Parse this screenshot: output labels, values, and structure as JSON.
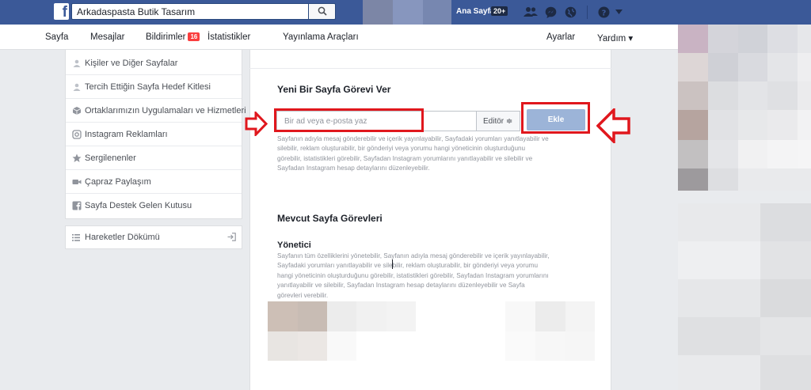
{
  "topbar": {
    "search_value": "Arkadaspasta Butik Tasarım",
    "home_label": "Ana Sayfa",
    "home_badge": "20+"
  },
  "pagenav": {
    "items": [
      {
        "label": "Sayfa"
      },
      {
        "label": "Mesajlar"
      },
      {
        "label": "Bildirimler",
        "badge": "16"
      },
      {
        "label": "İstatistikler"
      },
      {
        "label": "Yayınlama Araçları"
      }
    ],
    "settings_label": "Ayarlar",
    "help_label": "Yardım ▾"
  },
  "sidebar": {
    "items": [
      {
        "label": "Kişiler ve Diğer Sayfalar",
        "icon": "people-icon"
      },
      {
        "label": "Tercih Ettiğin Sayfa Hedef Kitlesi",
        "icon": "people-icon"
      },
      {
        "label": "Ortaklarımızın Uygulamaları ve Hizmetleri",
        "icon": "cube-icon"
      },
      {
        "label": "Instagram Reklamları",
        "icon": "instagram-icon"
      },
      {
        "label": "Sergilenenler",
        "icon": "star-icon"
      },
      {
        "label": "Çapraz Paylaşım",
        "icon": "video-icon"
      },
      {
        "label": "Sayfa Destek Gelen Kutusu",
        "icon": "facebook-icon"
      }
    ],
    "activity_log_label": "Hareketler Dökümü"
  },
  "main": {
    "new_role_title": "Yeni Bir Sayfa Görevi Ver",
    "input_placeholder": "Bir ad veya e-posta yaz",
    "role_select": "Editör ≑",
    "add_label": "Ekle",
    "editor_desc": [
      "Sayfanın adıyla mesaj gönderebilir ve içerik yayınlayabilir, Sayfadaki yorumları yanıtlayabilir ve",
      "silebilir, reklam oluşturabilir, bir gönderiyi veya yorumu hangi yöneticinin oluşturduğunu",
      "görebilir, istatistikleri görebilir, Sayfadan Instagram yorumlarını yanıtlayabilir ve silebilir ve",
      "Sayfadan Instagram hesap detaylarını düzenleyebilir."
    ],
    "existing_title": "Mevcut Sayfa Görevleri",
    "admin_title": "Yönetici",
    "admin_desc": [
      "Sayfanın tüm özelliklerini yönetebilir, Sayfanın adıyla mesaj gönderebilir ve içerik yayınlayabilir,",
      "Sayfadaki yorumları yanıtlayabilir ve silebilir, reklam oluşturabilir, bir gönderiyi veya yorumu",
      "hangi yöneticinin oluşturduğunu görebilir, istatistikleri görebilir, Sayfadan Instagram yorumlarını",
      "yanıtlayabilir ve silebilir, Sayfadan Instagram hesap detaylarını düzenleyebilir ve Sayfa",
      "görevleri verebilir."
    ]
  },
  "colors": {
    "facebook_blue": "#3b5998",
    "highlight_red": "#e0171d",
    "add_button": "#9cb4d8"
  }
}
